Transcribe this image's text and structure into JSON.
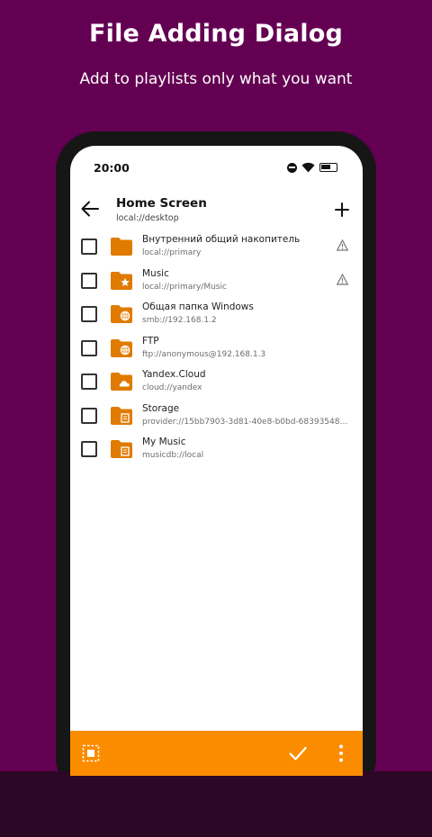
{
  "promo": {
    "title": "File Adding Dialog",
    "subtitle": "Add to playlists only what you want"
  },
  "status_bar": {
    "time": "20:00",
    "icons": [
      "dnd-icon",
      "wifi-icon",
      "battery-icon"
    ]
  },
  "header": {
    "title": "Home Screen",
    "path": "local://desktop",
    "back_icon": "arrow-left-icon",
    "add_icon": "plus-icon"
  },
  "items": [
    {
      "name": "Внутренний общий накопитель",
      "path": "local://primary",
      "badge": "none",
      "warning": true
    },
    {
      "name": "Music",
      "path": "local://primary/Music",
      "badge": "star",
      "warning": true
    },
    {
      "name": "Общая папка Windows",
      "path": "smb://192.168.1.2",
      "badge": "globe",
      "warning": false
    },
    {
      "name": "FTP",
      "path": "ftp://anonymous@192.168.1.3",
      "badge": "globe",
      "warning": false
    },
    {
      "name": "Yandex.Cloud",
      "path": "cloud://yandex",
      "badge": "cloud",
      "warning": false
    },
    {
      "name": "Storage",
      "path": "provider://15bb7903-3d81-40e8-b0bd-6839354883 …",
      "badge": "provider",
      "warning": false
    },
    {
      "name": "My Music",
      "path": "musicdb://local",
      "badge": "provider",
      "warning": false
    }
  ],
  "toolbar": {
    "select_icon": "select-all-icon",
    "confirm_icon": "check-icon",
    "more_icon": "more-vertical-icon"
  },
  "colors": {
    "background": "#640052",
    "accent": "#fb8c00",
    "folder": "#e07b00"
  }
}
